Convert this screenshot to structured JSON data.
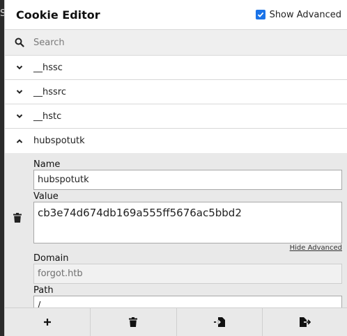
{
  "background": {
    "edge_text": "S"
  },
  "header": {
    "title": "Cookie Editor",
    "show_advanced_label": "Show Advanced",
    "show_advanced_checked": true
  },
  "search": {
    "placeholder": "Search"
  },
  "cookies": [
    {
      "name": "__hssc",
      "expanded": false
    },
    {
      "name": "__hssrc",
      "expanded": false
    },
    {
      "name": "__hstc",
      "expanded": false
    },
    {
      "name": "hubspotutk",
      "expanded": true
    }
  ],
  "detail": {
    "name_label": "Name",
    "name_value": "hubspotutk",
    "value_label": "Value",
    "value_value": "cb3e74d674db169a555ff5676ac5bbd2",
    "hide_advanced": "Hide Advanced",
    "domain_label": "Domain",
    "domain_value": "forgot.htb",
    "path_label": "Path",
    "path_value": "/"
  },
  "toolbar": {
    "buttons": [
      "add-icon",
      "delete-all-icon",
      "import-icon",
      "export-icon"
    ]
  },
  "colors": {
    "accent": "#1a73e8",
    "panel": "#e9e9e9"
  }
}
